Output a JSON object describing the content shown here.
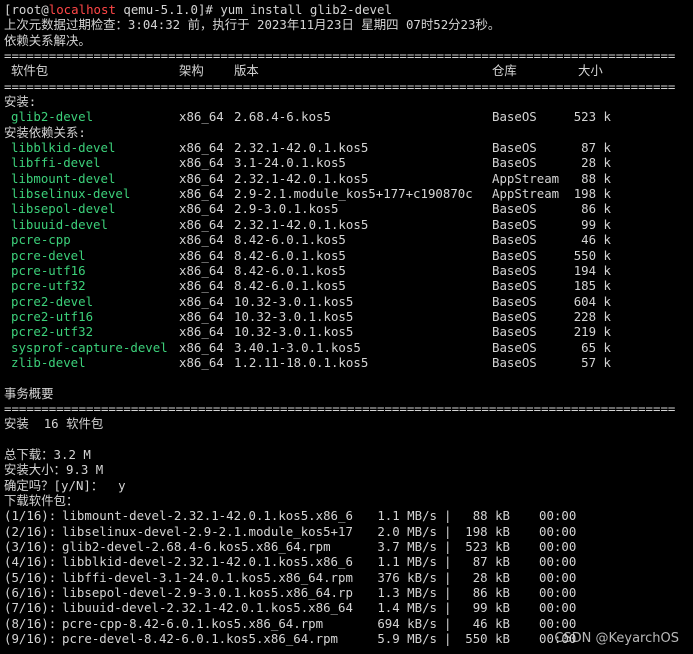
{
  "prompt": {
    "open": "[root@",
    "host": "localhost",
    "rest": " qemu-5.1.0]# yum install glib2-devel"
  },
  "meta_check": "上次元数据过期检查：3:04:32 前，执行于 2023年11月23日 星期四 07时52分23秒。",
  "resolving": "依赖关系解决。",
  "separator": "==========================================================================================",
  "headers": {
    "package": "软件包",
    "arch": "架构",
    "version": "版本",
    "repo": "仓库",
    "size": "大小"
  },
  "installing_label": "安装:",
  "installing": [
    {
      "name": "glib2-devel",
      "arch": "x86_64",
      "version": "2.68.4-6.kos5",
      "repo": "BaseOS",
      "size": "523 k"
    }
  ],
  "deps_label": "安装依赖关系:",
  "deps": [
    {
      "name": "libblkid-devel",
      "arch": "x86_64",
      "version": "2.32.1-42.0.1.kos5",
      "repo": "BaseOS",
      "size": "87 k"
    },
    {
      "name": "libffi-devel",
      "arch": "x86_64",
      "version": "3.1-24.0.1.kos5",
      "repo": "BaseOS",
      "size": "28 k"
    },
    {
      "name": "libmount-devel",
      "arch": "x86_64",
      "version": "2.32.1-42.0.1.kos5",
      "repo": "AppStream",
      "size": "88 k"
    },
    {
      "name": "libselinux-devel",
      "arch": "x86_64",
      "version": "2.9-2.1.module_kos5+177+c190870c",
      "repo": "AppStream",
      "size": "198 k"
    },
    {
      "name": "libsepol-devel",
      "arch": "x86_64",
      "version": "2.9-3.0.1.kos5",
      "repo": "BaseOS",
      "size": "86 k"
    },
    {
      "name": "libuuid-devel",
      "arch": "x86_64",
      "version": "2.32.1-42.0.1.kos5",
      "repo": "BaseOS",
      "size": "99 k"
    },
    {
      "name": "pcre-cpp",
      "arch": "x86_64",
      "version": "8.42-6.0.1.kos5",
      "repo": "BaseOS",
      "size": "46 k"
    },
    {
      "name": "pcre-devel",
      "arch": "x86_64",
      "version": "8.42-6.0.1.kos5",
      "repo": "BaseOS",
      "size": "550 k"
    },
    {
      "name": "pcre-utf16",
      "arch": "x86_64",
      "version": "8.42-6.0.1.kos5",
      "repo": "BaseOS",
      "size": "194 k"
    },
    {
      "name": "pcre-utf32",
      "arch": "x86_64",
      "version": "8.42-6.0.1.kos5",
      "repo": "BaseOS",
      "size": "185 k"
    },
    {
      "name": "pcre2-devel",
      "arch": "x86_64",
      "version": "10.32-3.0.1.kos5",
      "repo": "BaseOS",
      "size": "604 k"
    },
    {
      "name": "pcre2-utf16",
      "arch": "x86_64",
      "version": "10.32-3.0.1.kos5",
      "repo": "BaseOS",
      "size": "228 k"
    },
    {
      "name": "pcre2-utf32",
      "arch": "x86_64",
      "version": "10.32-3.0.1.kos5",
      "repo": "BaseOS",
      "size": "219 k"
    },
    {
      "name": "sysprof-capture-devel",
      "arch": "x86_64",
      "version": "3.40.1-3.0.1.kos5",
      "repo": "BaseOS",
      "size": "65 k"
    },
    {
      "name": "zlib-devel",
      "arch": "x86_64",
      "version": "1.2.11-18.0.1.kos5",
      "repo": "BaseOS",
      "size": "57 k"
    }
  ],
  "summary_label": "事务概要",
  "install_count": "安装  16 软件包",
  "total_download": "总下载：3.2 M",
  "installed_size": "安装大小：9.3 M",
  "confirm": "确定吗？[y/N]：  y",
  "downloading": "下载软件包：",
  "downloads": [
    {
      "idx": "(1/16):",
      "file": "libmount-devel-2.32.1-42.0.1.kos5.x86_6",
      "rate": "1.1 MB/s",
      "size": "88 kB",
      "time": "00:00"
    },
    {
      "idx": "(2/16):",
      "file": "libselinux-devel-2.9-2.1.module_kos5+17",
      "rate": "2.0 MB/s",
      "size": "198 kB",
      "time": "00:00"
    },
    {
      "idx": "(3/16):",
      "file": "glib2-devel-2.68.4-6.kos5.x86_64.rpm",
      "rate": "3.7 MB/s",
      "size": "523 kB",
      "time": "00:00"
    },
    {
      "idx": "(4/16):",
      "file": "libblkid-devel-2.32.1-42.0.1.kos5.x86_6",
      "rate": "1.1 MB/s",
      "size": "87 kB",
      "time": "00:00"
    },
    {
      "idx": "(5/16):",
      "file": "libffi-devel-3.1-24.0.1.kos5.x86_64.rpm",
      "rate": "376 kB/s",
      "size": "28 kB",
      "time": "00:00"
    },
    {
      "idx": "(6/16):",
      "file": "libsepol-devel-2.9-3.0.1.kos5.x86_64.rp",
      "rate": "1.3 MB/s",
      "size": "86 kB",
      "time": "00:00"
    },
    {
      "idx": "(7/16):",
      "file": "libuuid-devel-2.32.1-42.0.1.kos5.x86_64",
      "rate": "1.4 MB/s",
      "size": "99 kB",
      "time": "00:00"
    },
    {
      "idx": "(8/16):",
      "file": "pcre-cpp-8.42-6.0.1.kos5.x86_64.rpm",
      "rate": "694 kB/s",
      "size": "46 kB",
      "time": "00:00"
    },
    {
      "idx": "(9/16):",
      "file": "pcre-devel-8.42-6.0.1.kos5.x86_64.rpm",
      "rate": "5.9 MB/s",
      "size": "550 kB",
      "time": "00:00"
    }
  ],
  "watermark": "CSDN @KeyarchOS",
  "colors": {
    "background": "#000000",
    "text": "#d4d4d4",
    "package": "#3cd07a",
    "host": "#ff4747"
  }
}
